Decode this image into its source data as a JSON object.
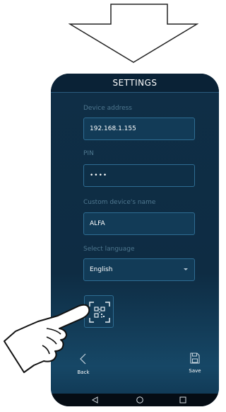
{
  "header": {
    "title": "SETTINGS"
  },
  "form": {
    "device_address": {
      "label": "Device address",
      "value": "192.168.1.155"
    },
    "pin": {
      "label": "PIN",
      "value": "••••"
    },
    "custom_name": {
      "label": "Custom device's name",
      "value": "ALFA"
    },
    "language": {
      "label": "Select language",
      "value": "English"
    }
  },
  "bottom_bar": {
    "back_label": "Back",
    "save_label": "Save"
  },
  "icons": {
    "arrow": "down-arrow-icon",
    "qr": "qr-code-icon",
    "back": "chevron-left-icon",
    "save": "save-icon",
    "hand": "pointing-hand-icon",
    "sys_back": "triangle-back-icon",
    "sys_home": "circle-home-icon",
    "sys_recent": "square-recent-icon"
  },
  "colors": {
    "background": "#0d2a40",
    "field_border": "#2e6d93",
    "label": "#4f7890"
  }
}
